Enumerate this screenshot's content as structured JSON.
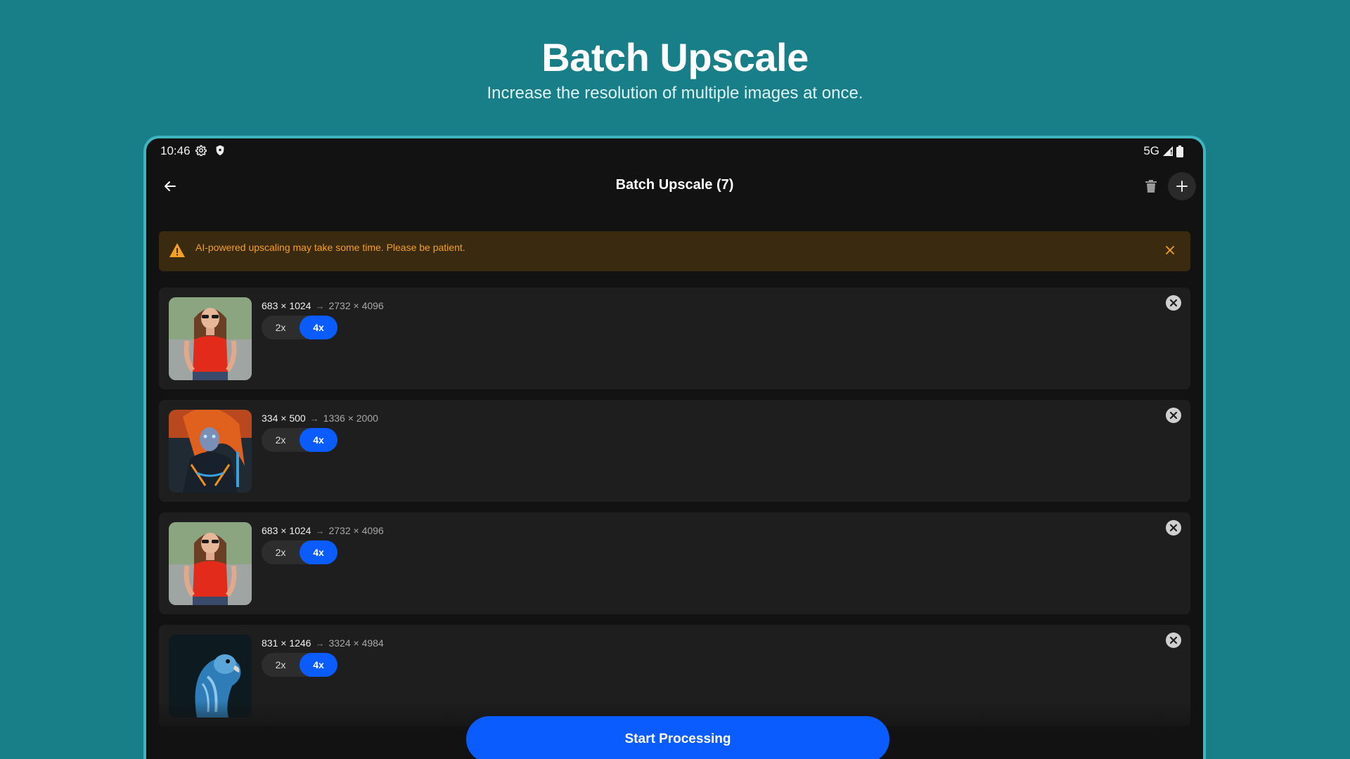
{
  "hero": {
    "title": "Batch Upscale",
    "subtitle": "Increase the resolution of multiple images at once."
  },
  "status_bar": {
    "time": "10:46",
    "network": "5G",
    "icons": [
      "gear-icon",
      "shield-icon",
      "signal-icon",
      "battery-icon"
    ]
  },
  "app_bar": {
    "title": "Batch Upscale (7)",
    "back_icon": "arrow-left-icon",
    "delete_icon": "trash-icon",
    "add_icon": "plus-icon"
  },
  "warning": {
    "text": "AI-powered upscaling may take some time. Please be patient.",
    "color": "#f4a024",
    "icon": "warning-triangle-icon",
    "close_icon": "close-icon"
  },
  "images": [
    {
      "thumb": "woman-red-top",
      "source": "683 × 1024",
      "arrow": "→",
      "target": "2732 × 4096",
      "options": [
        "2x",
        "4x"
      ],
      "selected": "4x"
    },
    {
      "thumb": "red-hair-warrior",
      "source": "334 × 500",
      "arrow": "→",
      "target": "1336 × 2000",
      "options": [
        "2x",
        "4x"
      ],
      "selected": "4x"
    },
    {
      "thumb": "woman-red-top",
      "source": "683 × 1024",
      "arrow": "→",
      "target": "2732 × 4096",
      "options": [
        "2x",
        "4x"
      ],
      "selected": "4x"
    },
    {
      "thumb": "blue-parrot",
      "source": "831 × 1246",
      "arrow": "→",
      "target": "3324 × 4984",
      "options": [
        "2x",
        "4x"
      ],
      "selected": "4x"
    }
  ],
  "actions": {
    "start_label": "Start Processing"
  },
  "colors": {
    "background": "#187e87",
    "accent": "#0a5cff",
    "device_frame": "#3fb5bf",
    "surface": "#1e1e1e"
  }
}
